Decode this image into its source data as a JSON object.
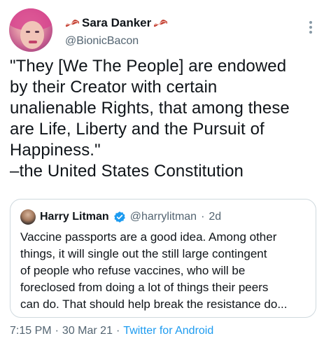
{
  "author": {
    "display_name": "Sara Danker",
    "handle": "@BionicBacon"
  },
  "tweet": {
    "text": "\"They [We The People] are endowed\nby their Creator with certain\nunalienable Rights, that among these\nare Life, Liberty and the Pursuit of\nHappiness.\"\n–the United States Constitution"
  },
  "quoted": {
    "display_name": "Harry Litman",
    "handle": "@harrylitman",
    "separator": "·",
    "time": "2d",
    "text": "Vaccine passports are a good idea. Among other\nthings, it will single out the still large contingent\nof people who refuse vaccines, who will be\nforeclosed from doing a lot of things their peers\ncan do.  That should help break the resistance do..."
  },
  "meta": {
    "time": "7:15 PM",
    "sep1": "·",
    "date": "30 Mar 21",
    "sep2": "·",
    "source": "Twitter for Android"
  },
  "colors": {
    "link": "#1d9bf0",
    "secondary_text": "#536471",
    "border": "#cfd9de",
    "verified": "#1d9bf0"
  },
  "icons": {
    "name_decoration": "bacon-icon",
    "verified": "verified-badge-icon",
    "more": "more-vertical-icon"
  }
}
